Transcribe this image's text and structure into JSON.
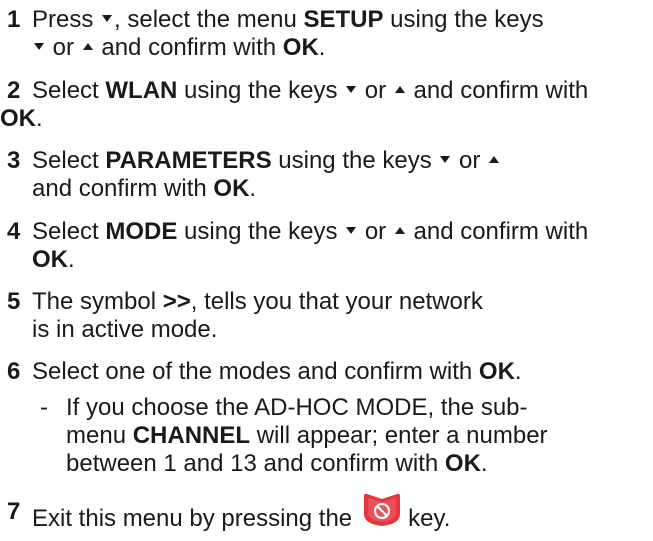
{
  "steps": [
    {
      "num": "1",
      "t1": "Press",
      "t2": ", select the menu",
      "b1": "SETUP",
      "t3": "using the keys",
      "t4": "or",
      "t5": "and confirm with",
      "b2": "OK",
      "t6": "."
    },
    {
      "num": "2",
      "t1": "Select",
      "b1": "WLAN",
      "t2": "using the keys",
      "t3": "or",
      "t4": "and confirm with",
      "b2": "OK",
      "t5": "."
    },
    {
      "num": "3",
      "t1": "Select",
      "b1": "PARAMETERS",
      "t2": "using the keys",
      "t3": "or",
      "t4": "and confirm with",
      "b2": "OK",
      "t5": "."
    },
    {
      "num": "4",
      "t1": "Select",
      "b1": "MODE",
      "t2": "using the keys",
      "t3": "or",
      "t4": "and confirm with",
      "b2": "OK",
      "t5": "."
    },
    {
      "num": "5",
      "t1": "The symbol",
      "b1": ">>",
      "t2": ", tells you that your network is in active mode."
    },
    {
      "num": "6",
      "t1": "Select one of the modes and confirm with",
      "b1": "OK",
      "t2": "."
    },
    {
      "num": "7",
      "t1": "Exit this menu by pressing the",
      "t2": "key."
    }
  ],
  "substep": {
    "dash": "-",
    "t1": "If you choose the AD-HOC MODE, the sub-menu",
    "b1": "CHANNEL",
    "t2": "will appear; enter a number between 1 and 13 and confirm with",
    "b2": "OK",
    "t3": "."
  },
  "icons": {
    "down_arrow": "down-triangle",
    "up_arrow": "up-triangle",
    "key": "red-stop-key-icon",
    "key_color": "#e3373f"
  }
}
